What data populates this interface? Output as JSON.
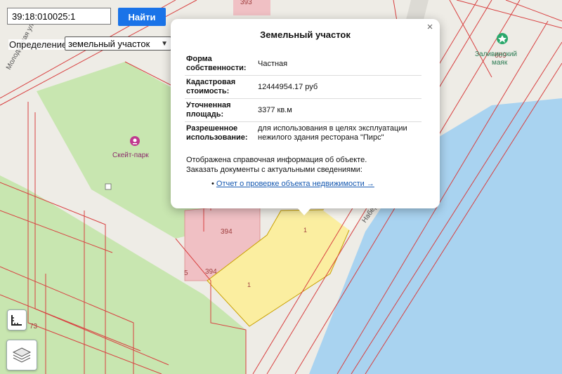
{
  "search": {
    "value": "39:18:010025:1",
    "button_label": "Найти"
  },
  "definition": {
    "label": "Определение:",
    "selected": "земельный участок"
  },
  "popup": {
    "title": "Земельный участок",
    "close_symbol": "×",
    "rows": [
      {
        "key": "Форма собственности:",
        "value": "Частная"
      },
      {
        "key": "Кадастровая стоимость:",
        "value": "12444954.17 руб"
      },
      {
        "key": "Уточненная площадь:",
        "value": "3377 кв.м"
      },
      {
        "key": "Разрешенное использование:",
        "value": "для использования в целях эксплуатации нежилого здания ресторана \"Пирс\""
      }
    ],
    "note_line1": "Отображена справочная информация об объекте.",
    "note_line2": "Заказать документы с актуальными сведениями:",
    "bullet": "•",
    "link_text": "Отчет о проверке объекта недвижимости →"
  },
  "map_labels": {
    "skatepark": "Скейт-парк",
    "lighthouse_line1": "Заливинский",
    "lighthouse_line2": "маяк",
    "street_left": "Молодёжная ул.",
    "street_right": "Набережная",
    "num_393": "393",
    "num_394a": "394",
    "num_394b": "394",
    "num_609": "609",
    "num_5": "5",
    "num_73": "73",
    "parcel_1a": "1",
    "parcel_1b": "1"
  },
  "icons": {
    "skatepark": "skatepark-pin-icon",
    "lighthouse": "lighthouse-pin-icon",
    "measure": "measure-tool-icon",
    "layers": "layers-icon"
  },
  "colors": {
    "water": "#a9d3f0",
    "park": "#c8e6b0",
    "building": "#f0c0c4",
    "parcel": "#fbeea0",
    "cadastral_line": "#d84040",
    "accent": "#1a73e8",
    "poi_pink": "#c0398f",
    "poi_green": "#2aa86b"
  }
}
